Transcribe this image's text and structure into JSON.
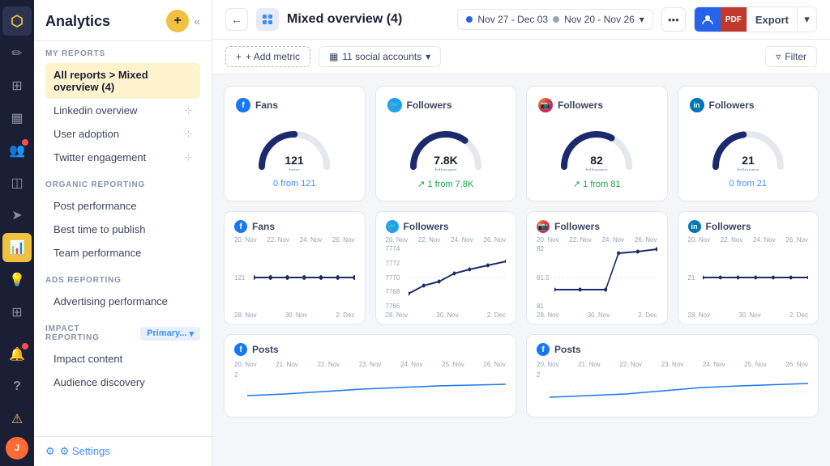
{
  "app": {
    "title": "Analytics"
  },
  "iconBar": {
    "items": [
      {
        "name": "logo",
        "icon": "⬡",
        "active": false
      },
      {
        "name": "compose",
        "icon": "✏️",
        "active": false
      },
      {
        "name": "grid",
        "icon": "⊞",
        "active": false
      },
      {
        "name": "calendar",
        "icon": "📅",
        "active": false
      },
      {
        "name": "people",
        "icon": "👥",
        "active": false,
        "badge": true
      },
      {
        "name": "inbox",
        "icon": "📥",
        "active": false
      },
      {
        "name": "send",
        "icon": "📤",
        "active": false
      },
      {
        "name": "analytics",
        "icon": "📊",
        "active": true
      },
      {
        "name": "lightbulb",
        "icon": "💡",
        "active": false
      },
      {
        "name": "apps",
        "icon": "⊞",
        "active": false
      },
      {
        "name": "bell",
        "icon": "🔔",
        "active": false,
        "badge": true
      },
      {
        "name": "question",
        "icon": "?",
        "active": false
      },
      {
        "name": "warning",
        "icon": "⚠",
        "accent": true
      }
    ]
  },
  "sidebar": {
    "title": "Analytics",
    "sections": [
      {
        "label": "MY REPORTS",
        "items": [
          {
            "label": "All reports > Mixed overview (4)",
            "active": true,
            "pin": false
          },
          {
            "label": "Linkedin overview",
            "active": false,
            "pin": true
          },
          {
            "label": "User adoption",
            "active": false,
            "pin": true
          },
          {
            "label": "Twitter engagement",
            "active": false,
            "pin": true
          }
        ]
      },
      {
        "label": "ORGANIC REPORTING",
        "items": [
          {
            "label": "Post performance",
            "active": false
          },
          {
            "label": "Best time to publish",
            "active": false
          },
          {
            "label": "Team performance",
            "active": false
          }
        ]
      },
      {
        "label": "ADS REPORTING",
        "items": [
          {
            "label": "Advertising performance",
            "active": false
          }
        ]
      },
      {
        "label": "IMPACT REPORTING",
        "badgeLabel": "Primary...",
        "items": [
          {
            "label": "Impact content",
            "active": false
          },
          {
            "label": "Audience discovery",
            "active": false
          }
        ]
      }
    ],
    "settings": "⚙ Settings"
  },
  "topbar": {
    "reportTitle": "Mixed overview (4)",
    "dateRange1": "Nov 27 - Dec 03",
    "dateRange2": "Nov 20 - Nov 26",
    "exportLabel": "Export"
  },
  "filterbar": {
    "addMetric": "+ Add metric",
    "accounts": "11 social accounts",
    "filter": "Filter"
  },
  "gaugeCards": [
    {
      "platform": "fb",
      "platformLabel": "f",
      "title": "Fans",
      "value": "121",
      "sublabel": "fans",
      "delta": "0 from 121",
      "deltaUp": false,
      "gaugePercent": 0.5
    },
    {
      "platform": "tw",
      "platformLabel": "🐦",
      "title": "Followers",
      "value": "7.8K",
      "sublabel": "followers",
      "delta": "↗ 1 from 7.8K",
      "deltaUp": true,
      "gaugePercent": 0.7
    },
    {
      "platform": "ig",
      "platformLabel": "📷",
      "title": "Followers",
      "value": "82",
      "sublabel": "followers",
      "delta": "↗ 1 from 81",
      "deltaUp": true,
      "gaugePercent": 0.65
    },
    {
      "platform": "li",
      "platformLabel": "in",
      "title": "Followers",
      "value": "21",
      "sublabel": "followers",
      "delta": "0 from 21",
      "deltaUp": false,
      "gaugePercent": 0.45
    }
  ],
  "chartCards": [
    {
      "platform": "fb",
      "platformLabel": "f",
      "title": "Fans",
      "xLabels": [
        "20. Nov",
        "22. Nov",
        "24. Nov",
        "26. Nov"
      ],
      "xLabelsBottom": [
        "28. Nov",
        "30. Nov",
        "2. Dec"
      ],
      "yLabels": [
        "",
        "121",
        ""
      ],
      "baseline": 121,
      "lineType": "flat"
    },
    {
      "platform": "tw",
      "platformLabel": "🐦",
      "title": "Followers",
      "xLabels": [
        "20. Nov",
        "22. Nov",
        "24. Nov",
        "26. Nov"
      ],
      "xLabelsBottom": [
        "28. Nov",
        "30. Nov",
        "2. Dec"
      ],
      "yLabels": [
        "7774",
        "7772",
        "7770",
        "7768",
        "7766"
      ],
      "baseline": 7770,
      "lineType": "wave"
    },
    {
      "platform": "ig",
      "platformLabel": "📷",
      "title": "Followers",
      "xLabels": [
        "20. Nov",
        "22. Nov",
        "24. Nov",
        "26. Nov"
      ],
      "xLabelsBottom": [
        "28. Nov",
        "30. Nov",
        "2. Dec"
      ],
      "yLabels": [
        "82",
        "81.5",
        "81"
      ],
      "baseline": 81.5,
      "lineType": "spike"
    },
    {
      "platform": "li",
      "platformLabel": "in",
      "title": "Followers",
      "xLabels": [
        "20. Nov",
        "22. Nov",
        "24. Nov",
        "26. Nov"
      ],
      "xLabelsBottom": [
        "28. Nov",
        "30. Nov",
        "2. Dec"
      ],
      "yLabels": [
        "",
        "21",
        ""
      ],
      "baseline": 21,
      "lineType": "flat"
    }
  ],
  "postsCards": [
    {
      "platform": "fb",
      "platformLabel": "f",
      "title": "Posts",
      "xLabels": [
        "20. Nov",
        "21. Nov",
        "22. Nov",
        "23. Nov",
        "24. Nov",
        "25. Nov",
        "26. Nov"
      ],
      "yLabels": [
        "2"
      ]
    },
    {
      "platform": "fb",
      "platformLabel": "f",
      "title": "Posts",
      "xLabels": [
        "20. Nov",
        "21. Nov",
        "22. Nov",
        "23. Nov",
        "24. Nov",
        "25. Nov",
        "26. Nov"
      ],
      "yLabels": [
        "2"
      ]
    }
  ]
}
